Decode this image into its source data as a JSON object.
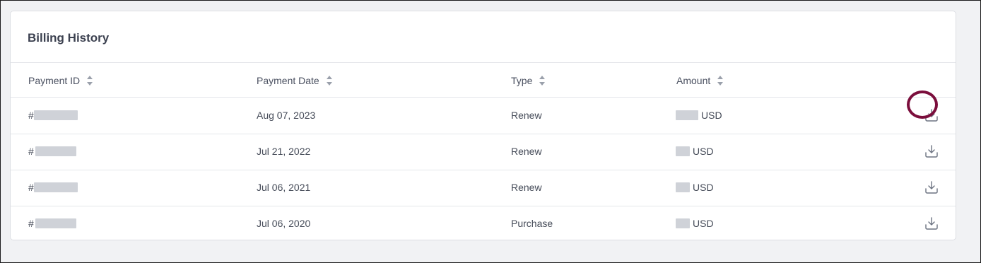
{
  "card": {
    "title": "Billing History"
  },
  "table": {
    "columns": [
      "Payment ID",
      "Payment Date",
      "Type",
      "Amount"
    ],
    "rows": [
      {
        "id_prefix": "#",
        "date": "Aug 07, 2023",
        "type": "Renew",
        "amount_suffix": "USD"
      },
      {
        "id_prefix": "#",
        "date": "Jul 21, 2022",
        "type": "Renew",
        "amount_suffix": "USD"
      },
      {
        "id_prefix": "#",
        "date": "Jul 06, 2021",
        "type": "Renew",
        "amount_suffix": "USD"
      },
      {
        "id_prefix": "#",
        "date": "Jul 06, 2020",
        "type": "Purchase",
        "amount_suffix": "USD"
      }
    ]
  },
  "icons": {
    "sort": "sort-arrows-icon",
    "download": "download-icon"
  },
  "colors": {
    "highlight": "#7b0e3c",
    "border": "#dcdee3",
    "background": "#f1f2f4"
  }
}
